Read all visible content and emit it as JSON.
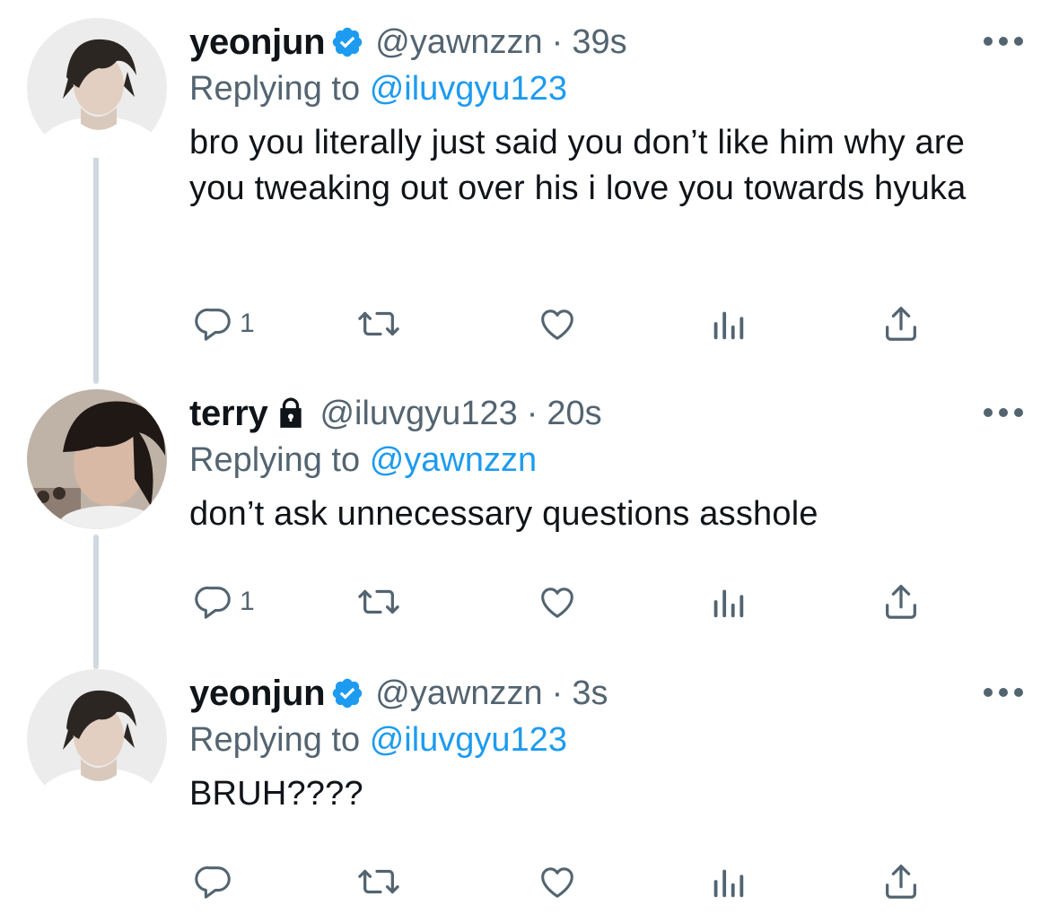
{
  "colors": {
    "text_primary": "#0f1419",
    "text_secondary": "#536471",
    "link": "#1d9bf0",
    "verified_badge": "#1d9bf0",
    "thread_line": "#cfd9de"
  },
  "tweets": [
    {
      "author_name": "yeonjun",
      "verified": true,
      "locked": false,
      "handle": "@yawnzzn",
      "separator": "·",
      "time": "39s",
      "replying_prefix": "Replying to",
      "replying_to": "@iluvgyu123",
      "text": "bro you literally just said you don’t like him why are you tweaking out over his i love you towards hyuka",
      "reply_count": "1",
      "icons": [
        "reply-icon",
        "retweet-icon",
        "like-icon",
        "views-icon",
        "share-icon"
      ]
    },
    {
      "author_name": "terry",
      "verified": false,
      "locked": true,
      "handle": "@iluvgyu123",
      "separator": "·",
      "time": "20s",
      "replying_prefix": "Replying to",
      "replying_to": "@yawnzzn",
      "text": "don’t ask unnecessary questions asshole",
      "reply_count": "1",
      "icons": [
        "reply-icon",
        "retweet-icon",
        "like-icon",
        "views-icon",
        "share-icon"
      ]
    },
    {
      "author_name": "yeonjun",
      "verified": true,
      "locked": false,
      "handle": "@yawnzzn",
      "separator": "·",
      "time": "3s",
      "replying_prefix": "Replying to",
      "replying_to": "@iluvgyu123",
      "text": "BRUH????",
      "reply_count": "",
      "icons": [
        "reply-icon",
        "retweet-icon",
        "like-icon",
        "views-icon",
        "share-icon"
      ]
    }
  ]
}
